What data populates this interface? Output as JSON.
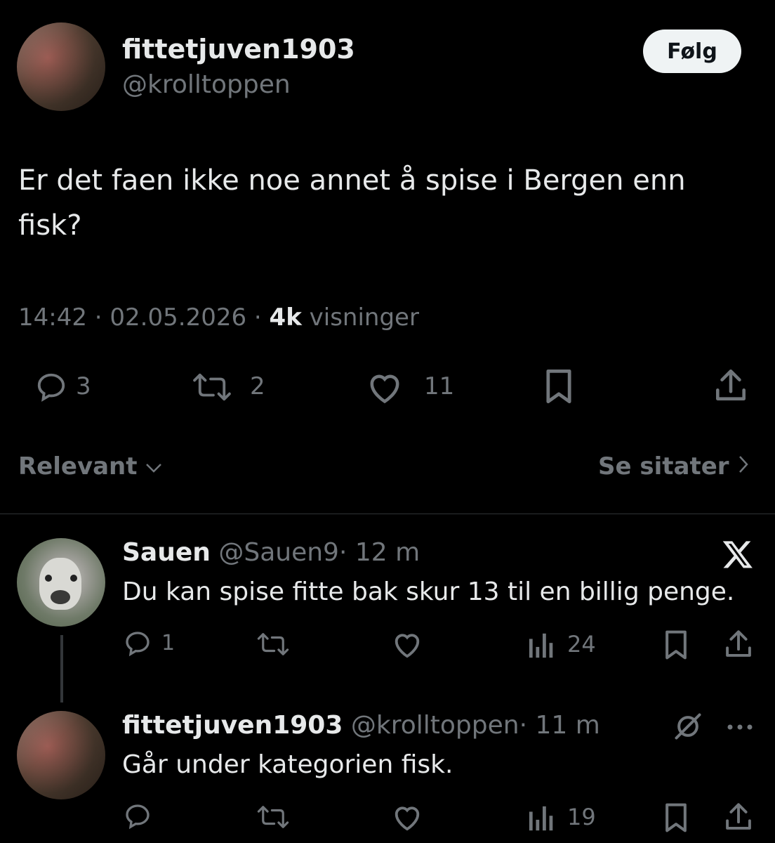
{
  "tweet": {
    "author_name": "fittetjuven1903",
    "author_handle": "@krolltoppen",
    "follow_label": "Følg",
    "text_line1": "Er det faen ikke noe annet å spise i Bergen enn",
    "text_line2": "fisk?",
    "time": "14:42",
    "sep1": "·",
    "date": "02.05.2026",
    "sep2": "·",
    "views_count": "4k",
    "views_label": "visninger",
    "replies": "3",
    "reposts": "2",
    "likes": "11"
  },
  "sort": {
    "relevant_label": "Relevant",
    "quotes_label": "Se sitater"
  },
  "reply1": {
    "name": "Sauen",
    "handle": "@Sauen9",
    "sep": "·",
    "time": "12 m",
    "text": "Du kan spise fitte bak skur 13 til en billig penge.",
    "replies": "1",
    "views": "24"
  },
  "reply2": {
    "name": "fittetjuven1903",
    "handle": "@krolltoppen",
    "sep": "·",
    "time": "11 m",
    "text": "Går under kategorien fisk.",
    "views": "19"
  },
  "colors": {
    "background": "#000000",
    "text": "#e7e9ea",
    "secondary": "#71767b",
    "follow_bg": "#eff3f4"
  }
}
